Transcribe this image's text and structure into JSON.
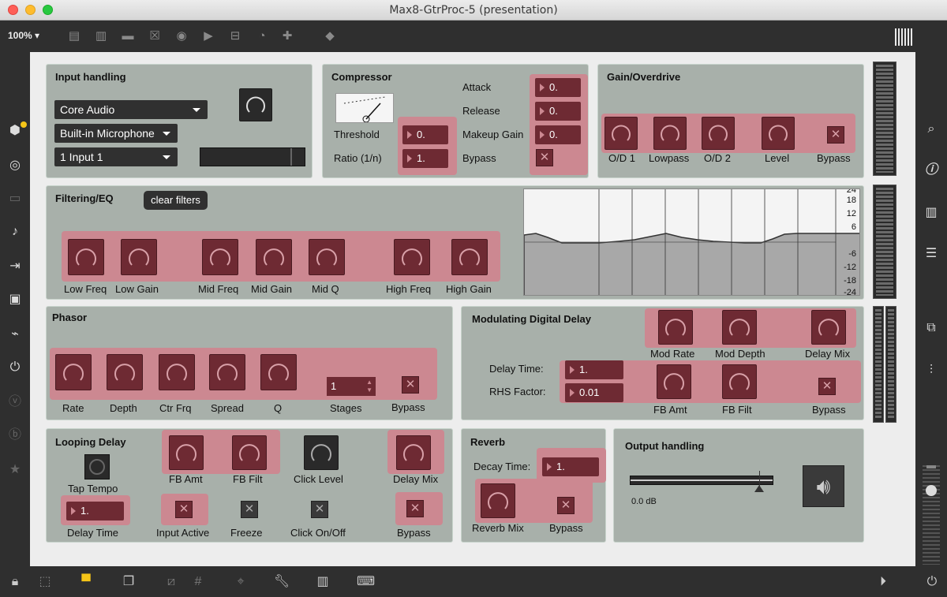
{
  "window": {
    "title": "Max8-GtrProc-5 (presentation)"
  },
  "toolbar": {
    "zoom": "100%"
  },
  "icons": {
    "lock": "lock-icon",
    "presentation": "presentation-icon",
    "search": "search-icon",
    "info": "info-icon",
    "speaker": "speaker-icon"
  },
  "input": {
    "title": "Input handling",
    "driver": "Core Audio",
    "device": "Built-in Microphone",
    "channel": "1 Input 1"
  },
  "compressor": {
    "title": "Compressor",
    "threshold_label": "Threshold",
    "threshold": "0.",
    "ratio_label": "Ratio (1/n)",
    "ratio": "1.",
    "attack_label": "Attack",
    "attack": "0.",
    "release_label": "Release",
    "release": "0.",
    "makeup_label": "Makeup Gain",
    "makeup": "0.",
    "bypass_label": "Bypass"
  },
  "gain": {
    "title": "Gain/Overdrive",
    "knobs": [
      "O/D 1",
      "Lowpass",
      "O/D 2",
      "Level"
    ],
    "bypass_label": "Bypass"
  },
  "filter": {
    "title": "Filtering/EQ",
    "clear_label": "clear filters",
    "knobs": [
      "Low Freq",
      "Low Gain",
      "Mid Freq",
      "Mid Gain",
      "Mid Q",
      "High Freq",
      "High Gain"
    ],
    "scale": [
      "24",
      "18",
      "12",
      "6",
      "-6",
      "-12",
      "-18",
      "-24"
    ]
  },
  "phasor": {
    "title": "Phasor",
    "knobs": [
      "Rate",
      "Depth",
      "Ctr Frq",
      "Spread",
      "Q"
    ],
    "stages_label": "Stages",
    "stages": "1",
    "bypass_label": "Bypass"
  },
  "delay": {
    "title": "Modulating Digital Delay",
    "knobs_top": [
      "Mod Rate",
      "Mod Depth",
      "Delay Mix"
    ],
    "delay_time_label": "Delay Time:",
    "delay_time": "1.",
    "rhs_label": "RHS Factor:",
    "rhs": "0.01",
    "fb_amt": "FB Amt",
    "fb_filt": "FB Filt",
    "bypass_label": "Bypass"
  },
  "looping": {
    "title": "Looping Delay",
    "tap_label": "Tap Tempo",
    "fb_amt": "FB Amt",
    "fb_filt": "FB Filt",
    "click_level": "Click Level",
    "delay_mix": "Delay Mix",
    "delay_time_label": "Delay Time",
    "delay_time": "1.",
    "input_active": "Input Active",
    "freeze": "Freeze",
    "click_onoff": "Click On/Off",
    "bypass_label": "Bypass"
  },
  "reverb": {
    "title": "Reverb",
    "decay_label": "Decay Time:",
    "decay": "1.",
    "mix_label": "Reverb Mix",
    "bypass_label": "Bypass"
  },
  "output": {
    "title": "Output handling",
    "gain_value": "0.0 dB"
  },
  "colors": {
    "panel": "#a8b0aa",
    "highlight": "#cc8891",
    "control": "#6e2a33"
  }
}
